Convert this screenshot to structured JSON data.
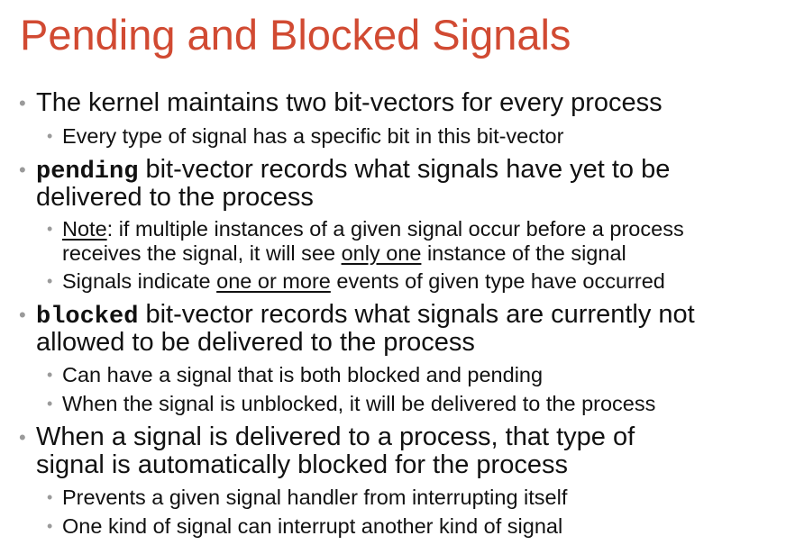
{
  "slide": {
    "title": "Pending and Blocked Signals",
    "colors": {
      "title": "#d14a32",
      "bullet": "#9a9a9a",
      "text": "#111111"
    },
    "bullets": {
      "b1": {
        "text": "The kernel maintains two bit-vectors for every process",
        "sub1": "Every type of signal has a specific bit in this bit-vector"
      },
      "b2": {
        "code": "pending",
        "line1_rest": " bit-vector records what signals have yet to be",
        "line2": "delivered to the process",
        "sub1": {
          "note": "Note",
          "line1_rest": ":  if multiple instances of a given signal occur before a process",
          "line2_pre": "receives the signal, it will see ",
          "line2_u": "only one",
          "line2_post": " instance of the signal"
        },
        "sub2": {
          "pre": "Signals indicate ",
          "u": "one or more",
          "post": " events of given type have occurred"
        }
      },
      "b3": {
        "code": "blocked",
        "line1_rest": " bit-vector records what signals are currently not",
        "line2": "allowed to be delivered to the process",
        "sub1": "Can have a signal that is both blocked and pending",
        "sub2": "When the signal is unblocked, it will be delivered to the process"
      },
      "b4": {
        "line1": "When a signal is delivered to a process, that type of",
        "line2": "signal is automatically blocked for the process",
        "sub1": "Prevents a given signal handler from interrupting itself",
        "sub2": "One kind of signal can interrupt another kind of signal"
      }
    }
  }
}
